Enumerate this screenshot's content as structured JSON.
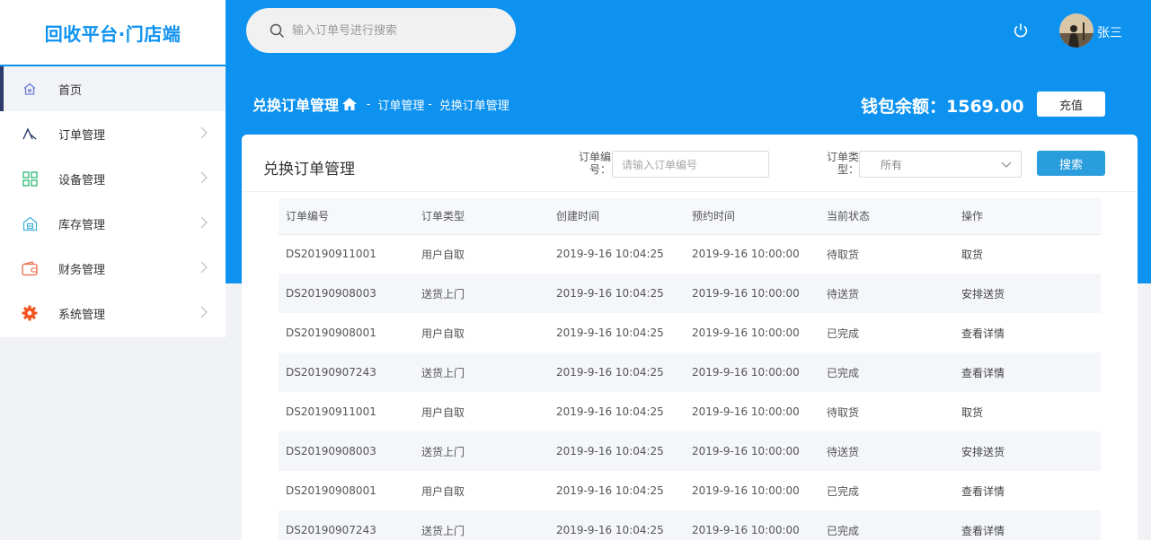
{
  "app": {
    "logo": "回收平台·门店端"
  },
  "search": {
    "placeholder": "输入订单号进行搜索"
  },
  "user": {
    "name": "张三"
  },
  "sidebar": {
    "items": [
      {
        "label": "首页",
        "icon": "home-icon"
      },
      {
        "label": "订单管理",
        "icon": "order-icon"
      },
      {
        "label": "设备管理",
        "icon": "grid-icon"
      },
      {
        "label": "库存管理",
        "icon": "warehouse-icon"
      },
      {
        "label": "财务管理",
        "icon": "wallet-icon"
      },
      {
        "label": "系统管理",
        "icon": "gear-icon"
      }
    ]
  },
  "breadcrumb": {
    "title": "兑换订单管理",
    "sep1": "-",
    "item1": "订单管理",
    "sep2": "-",
    "item2": "兑换订单管理"
  },
  "wallet": {
    "label": "钱包余额：",
    "value": "1569.00",
    "recharge": "充值"
  },
  "panel": {
    "title": "兑换订单管理",
    "order_no_label_1": "订单编",
    "order_no_label_2": "号：",
    "order_no_placeholder": "请输入订单编号",
    "type_label_1": "订单类",
    "type_label_2": "型：",
    "type_value": "所有",
    "search_button": "搜索"
  },
  "table": {
    "headers": [
      "订单编号",
      "订单类型",
      "创建时间",
      "预约时间",
      "当前状态",
      "操作"
    ],
    "rows": [
      [
        "DS20190911001",
        "用户自取",
        "2019-9-16 10:04:25",
        "2019-9-16 10:00:00",
        "待取货",
        "取货"
      ],
      [
        "DS20190908003",
        "送货上门",
        "2019-9-16 10:04:25",
        "2019-9-16 10:00:00",
        "待送货",
        "安排送货"
      ],
      [
        "DS20190908001",
        "用户自取",
        "2019-9-16 10:04:25",
        "2019-9-16 10:00:00",
        "已完成",
        "查看详情"
      ],
      [
        "DS20190907243",
        "送货上门",
        "2019-9-16 10:04:25",
        "2019-9-16 10:00:00",
        "已完成",
        "查看详情"
      ],
      [
        "DS20190911001",
        "用户自取",
        "2019-9-16 10:04:25",
        "2019-9-16 10:00:00",
        "待取货",
        "取货"
      ],
      [
        "DS20190908003",
        "送货上门",
        "2019-9-16 10:04:25",
        "2019-9-16 10:00:00",
        "待送货",
        "安排送货"
      ],
      [
        "DS20190908001",
        "用户自取",
        "2019-9-16 10:04:25",
        "2019-9-16 10:00:00",
        "已完成",
        "查看详情"
      ],
      [
        "DS20190907243",
        "送货上门",
        "2019-9-16 10:04:25",
        "2019-9-16 10:00:00",
        "已完成",
        "查看详情"
      ]
    ]
  },
  "colors": {
    "primary": "#0d92f0",
    "button": "#2a9ddc",
    "nav_active_bar": "#2d3a6b",
    "gear": "#f2541f",
    "wallet_icon": "#ef6b4a",
    "device_icon": "#2bb673",
    "order_icon": "#2d3a6b",
    "home_icon": "#6b7bd8"
  }
}
